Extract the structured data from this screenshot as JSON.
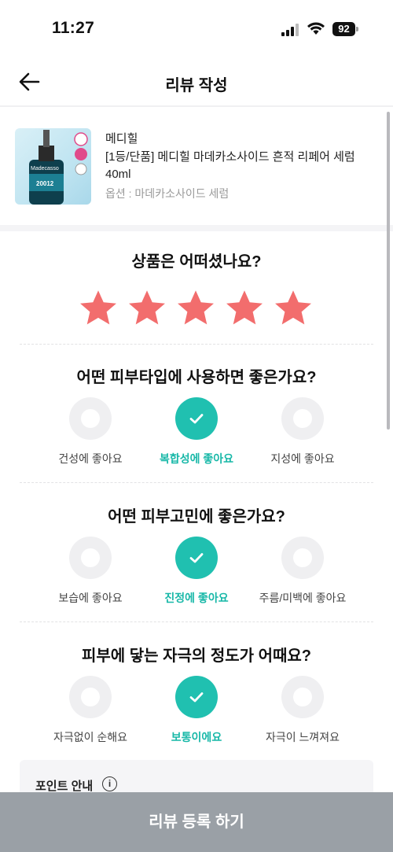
{
  "status_bar": {
    "time": "11:27",
    "battery": "92"
  },
  "header": {
    "title": "리뷰 작성"
  },
  "product": {
    "brand": "메디힐",
    "name": "[1등/단품] 메디힐 마데카소사이드 흔적 리페어 세럼 40ml",
    "option": "옵션 : 마데카소사이드 세럼",
    "thumb_text": "Madecasso",
    "thumb_code": "20012"
  },
  "rating": {
    "question": "상품은 어떠셨나요?",
    "stars": 5,
    "max_stars": 5,
    "star_color": "#f26d6d"
  },
  "questions": [
    {
      "question": "어떤 피부타입에 사용하면 좋은가요?",
      "options": [
        {
          "label": "건성에 좋아요",
          "selected": false
        },
        {
          "label": "복합성에 좋아요",
          "selected": true
        },
        {
          "label": "지성에 좋아요",
          "selected": false
        }
      ]
    },
    {
      "question": "어떤 피부고민에 좋은가요?",
      "options": [
        {
          "label": "보습에 좋아요",
          "selected": false
        },
        {
          "label": "진정에 좋아요",
          "selected": true
        },
        {
          "label": "주름/미백에 좋아요",
          "selected": false
        }
      ]
    },
    {
      "question": "피부에 닿는 자극의 정도가 어때요?",
      "options": [
        {
          "label": "자극없이 순해요",
          "selected": false
        },
        {
          "label": "보통이에요",
          "selected": true
        },
        {
          "label": "자극이 느껴져요",
          "selected": false
        }
      ]
    }
  ],
  "point_info": {
    "title": "포인트 안내",
    "icon": "info-icon"
  },
  "submit": {
    "label": "리뷰 등록 하기"
  },
  "colors": {
    "accent": "#20c0b0",
    "submit_bg": "#9aa0a6"
  }
}
